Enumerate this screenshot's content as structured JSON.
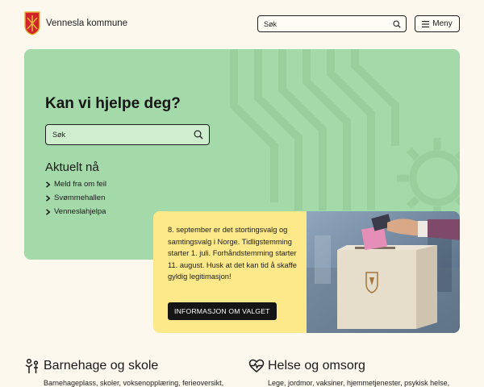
{
  "header": {
    "logo_text": "Vennesla kommune",
    "search_placeholder": "Søk",
    "menu_label": "Meny"
  },
  "hero": {
    "title": "Kan vi hjelpe deg?",
    "search_placeholder": "Søk",
    "aktuelt_title": "Aktuelt nå",
    "aktuelt_items": [
      "Meld fra om feil",
      "Svømmehallen",
      "Venneslahjelpa"
    ]
  },
  "election": {
    "text": "8. september er det stortingsvalg og samtingsvalg i Norge. Tidligstemming starter 1. juli. Forhåndstemming starter 11. august. Husk at det kan tid å skaffe gyldig legitimasjon!",
    "button_label": "INFORMASJON OM VALGET"
  },
  "sections": [
    {
      "title": "Barnehage og skole",
      "desc": "Barnehageplass, skoler, voksenopplæring, ferieoversikt,",
      "icon": "people-icon"
    },
    {
      "title": "Helse og omsorg",
      "desc": "Lege, jordmor, vaksiner, hjemmetjenester, psykisk helse,",
      "icon": "heart-pulse-icon"
    }
  ],
  "colors": {
    "background": "#fcf8ee",
    "hero_green": "#a4d9a9",
    "card_yellow": "#fde98a",
    "button_dark": "#151515",
    "logo_red": "#d2242a",
    "logo_gold": "#e3b43a"
  }
}
